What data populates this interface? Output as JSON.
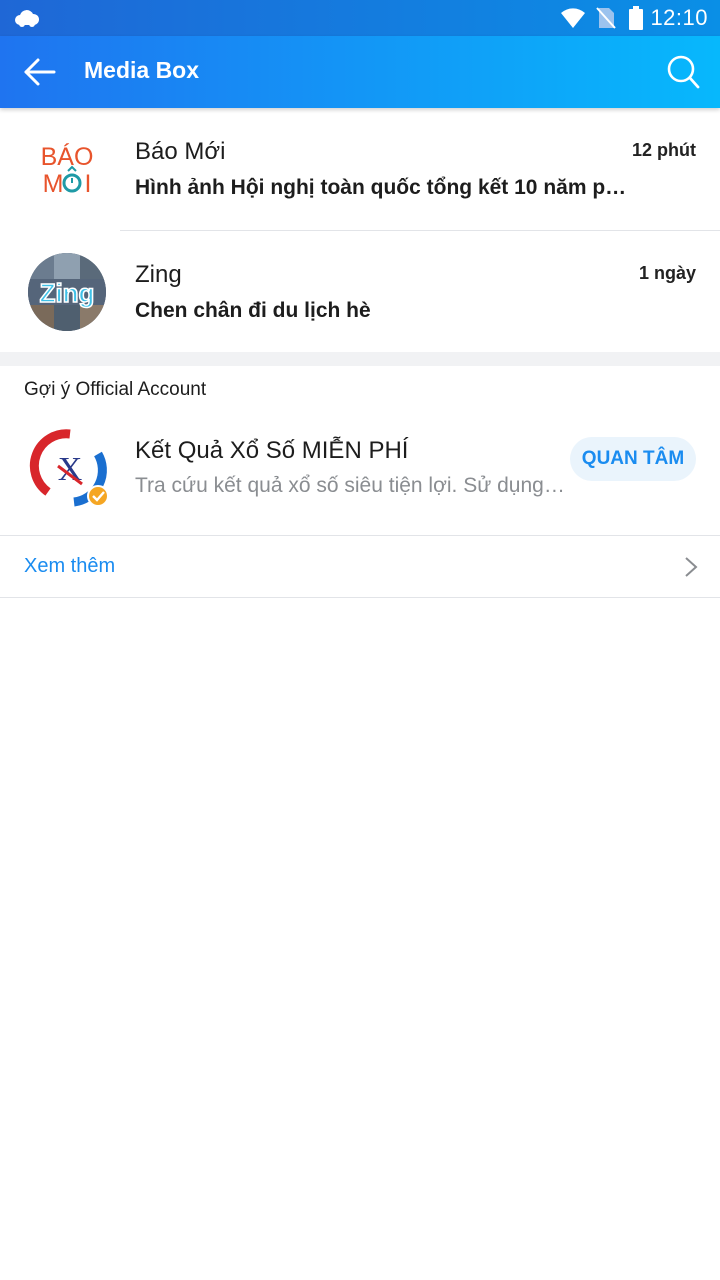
{
  "status_bar": {
    "time": "12:10",
    "icons": [
      "cloud-icon",
      "wifi-icon",
      "no-sim-icon",
      "battery-icon"
    ]
  },
  "app_bar": {
    "title": "Media Box",
    "icons": [
      "back-arrow-icon",
      "search-icon"
    ]
  },
  "media_items": [
    {
      "name": "Báo Mới",
      "time": "12 phút",
      "message": "Hình ảnh Hội nghị toàn quốc tổng kết 10 năm phòn…",
      "logo_text": [
        "BÁO",
        "MỚI"
      ]
    },
    {
      "name": "Zing",
      "time": "1 ngày",
      "message": "Chen chân đi du lịch hè",
      "logo_text": "Zing"
    }
  ],
  "suggestions": {
    "title": "Gợi ý Official Account",
    "items": [
      {
        "name": "Kết Quả Xổ Số MIỄN PHÍ",
        "description": "Tra cứu kết quả xổ số siêu tiện lợi. Sử dụng t…",
        "button": "QUAN TÂM"
      }
    ],
    "more_label": "Xem thêm"
  },
  "colors": {
    "accent": "#1a8cf0",
    "header_start": "#1f74f0",
    "header_end": "#07b8fc",
    "bao_moi_orange": "#e8542c",
    "bao_moi_teal": "#1f9aa6"
  }
}
